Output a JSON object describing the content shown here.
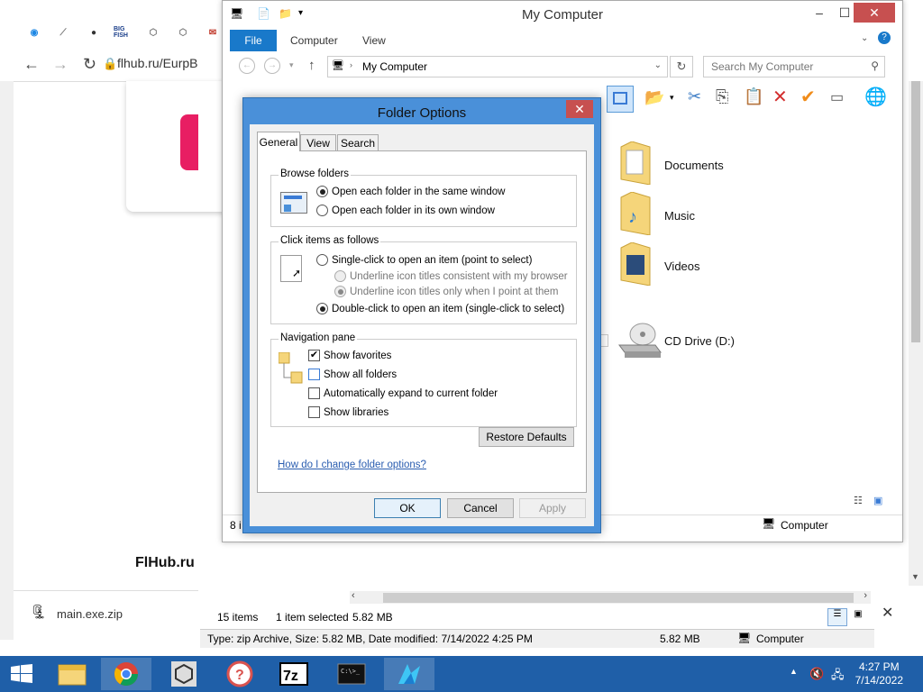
{
  "browser": {
    "url": "flhub.ru/EurpB",
    "site_name": "FlHub.ru",
    "download_file": "main.exe.zip",
    "bookmarks": [
      "circle-logo",
      "chart",
      "globe",
      "BIG FISH",
      "unity",
      "unity2",
      "mail"
    ]
  },
  "explorer_bg": {
    "items_count": "15 items",
    "selected": "1 item selected",
    "size": "5.82 MB",
    "info": "Type: zip Archive, Size: 5.82 MB, Date modified: 7/14/2022 4:25 PM",
    "info_size": "5.82 MB",
    "info_location": "Computer"
  },
  "my_computer": {
    "title": "My Computer",
    "tabs": [
      "File",
      "Computer",
      "View"
    ],
    "address": "My Computer",
    "search_placeholder": "Search My Computer",
    "items": [
      {
        "label": "Documents",
        "icon": "documents-folder"
      },
      {
        "label": "Music",
        "icon": "music-folder"
      },
      {
        "label": "Videos",
        "icon": "videos-folder"
      },
      {
        "label": "CD Drive (D:)",
        "icon": "cd-drive"
      }
    ],
    "status_count": "8 i",
    "status_location": "Computer"
  },
  "folder_options": {
    "title": "Folder Options",
    "tabs": [
      "General",
      "View",
      "Search"
    ],
    "browse": {
      "title": "Browse folders",
      "opt1": "Open each folder in the same window",
      "opt2": "Open each folder in its own window",
      "selected": 1
    },
    "click": {
      "title": "Click items as follows",
      "single": "Single-click to open an item (point to select)",
      "underline1": "Underline icon titles consistent with my browser",
      "underline2": "Underline icon titles only when I point at them",
      "double": "Double-click to open an item (single-click to select)"
    },
    "nav": {
      "title": "Navigation pane",
      "show_favorites": "Show favorites",
      "show_all_folders": "Show all folders",
      "auto_expand": "Automatically expand to current folder",
      "show_libraries": "Show libraries"
    },
    "restore": "Restore Defaults",
    "help": "How do I change folder options?",
    "ok": "OK",
    "cancel": "Cancel",
    "apply": "Apply"
  },
  "taskbar": {
    "time": "4:27 PM",
    "date": "7/14/2022",
    "accent": "#1f5fa8"
  }
}
